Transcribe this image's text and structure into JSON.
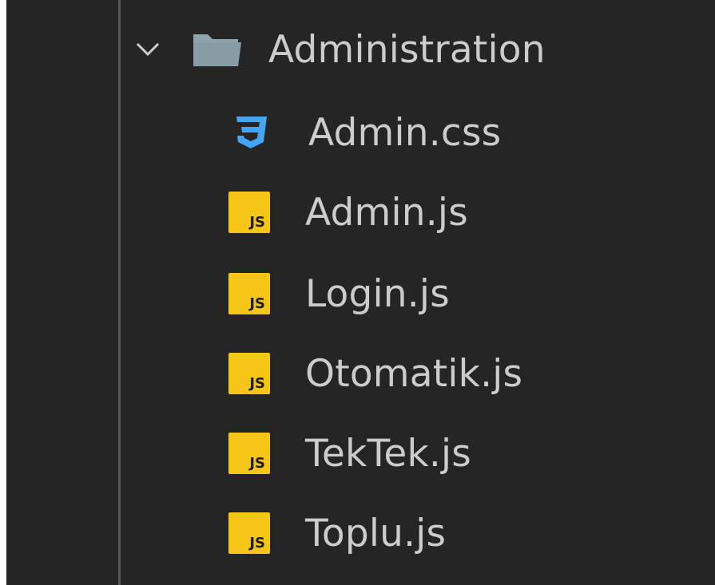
{
  "explorer": {
    "folder": {
      "name": "Administration",
      "expanded": true,
      "chevron_icon": "chevron-down-icon",
      "folder_icon": "folder-open-icon"
    },
    "files": [
      {
        "name": "Admin.css",
        "icon": "css-file-icon"
      },
      {
        "name": "Admin.js",
        "icon": "js-file-icon"
      },
      {
        "name": "Login.js",
        "icon": "js-file-icon"
      },
      {
        "name": "Otomatik.js",
        "icon": "js-file-icon"
      },
      {
        "name": "TekTek.js",
        "icon": "js-file-icon"
      },
      {
        "name": "Toplu.js",
        "icon": "js-file-icon"
      }
    ],
    "js_badge_text": "JS",
    "colors": {
      "background": "#252526",
      "text": "#cccccc",
      "js_badge": "#f5c518",
      "css_icon": "#42a5f5",
      "folder_icon": "#90a4ae",
      "indent_guide": "#585858"
    }
  }
}
